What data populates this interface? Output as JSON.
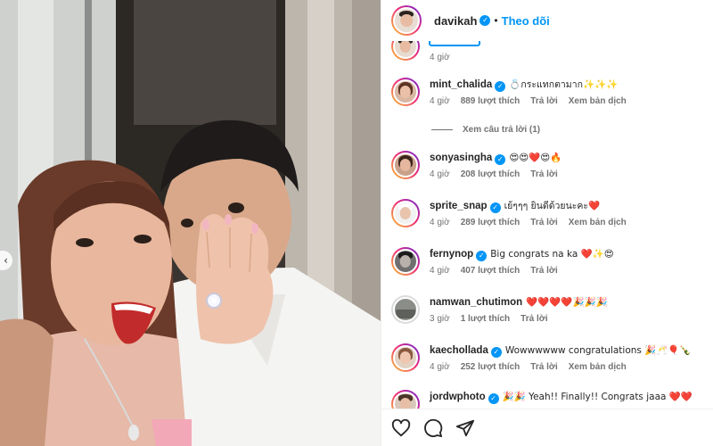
{
  "post": {
    "author": "davikah",
    "follow_label": "Theo dõi",
    "separator": "•"
  },
  "partial_comment": {
    "time": "4 giờ"
  },
  "view_replies": "Xem câu trả lời (1)",
  "comments": [
    {
      "username": "mint_chalida",
      "verified": true,
      "text": "💍กระแทกตามาก✨✨✨",
      "time": "4 giờ",
      "likes": "889 lượt thích",
      "reply": "Trả lời",
      "translate": "Xem bản dịch"
    },
    {
      "username": "sonyasingha",
      "verified": true,
      "text": "😍😍❤️😍🔥",
      "time": "4 giờ",
      "likes": "208 lượt thích",
      "reply": "Trả lời",
      "translate": ""
    },
    {
      "username": "sprite_snap",
      "verified": true,
      "text": "เย้ๆๆๆ ยินดีด้วยนะคะ❤️",
      "time": "4 giờ",
      "likes": "289 lượt thích",
      "reply": "Trả lời",
      "translate": "Xem bản dịch"
    },
    {
      "username": "fernynop",
      "verified": true,
      "text": "Big congrats na ka ❤️✨😍",
      "time": "4 giờ",
      "likes": "407 lượt thích",
      "reply": "Trả lời",
      "translate": ""
    },
    {
      "username": "namwan_chutimon",
      "verified": false,
      "text": "❤️❤️❤️❤️🎉🎉🎉",
      "time": "3 giờ",
      "likes": "1 lượt thích",
      "reply": "Trả lời",
      "translate": ""
    },
    {
      "username": "kaechollada",
      "verified": true,
      "text": "Wowwwwww congratulations 🎉🥂🎈🍾",
      "time": "4 giờ",
      "likes": "252 lượt thích",
      "reply": "Trả lời",
      "translate": "Xem bản dịch"
    },
    {
      "username": "jordwphoto",
      "verified": true,
      "text": "🎉🎉 Yeah!! Finally!! Congrats jaaa ❤️❤️",
      "time": "",
      "likes": "",
      "reply": "",
      "translate": ""
    }
  ],
  "colors": {
    "accent": "#0095f6",
    "meta_text": "#737373",
    "primary_text": "#262626"
  },
  "icons": [
    "heart-icon",
    "comment-icon",
    "share-icon",
    "chevron-left-icon",
    "verified-badge-icon"
  ]
}
